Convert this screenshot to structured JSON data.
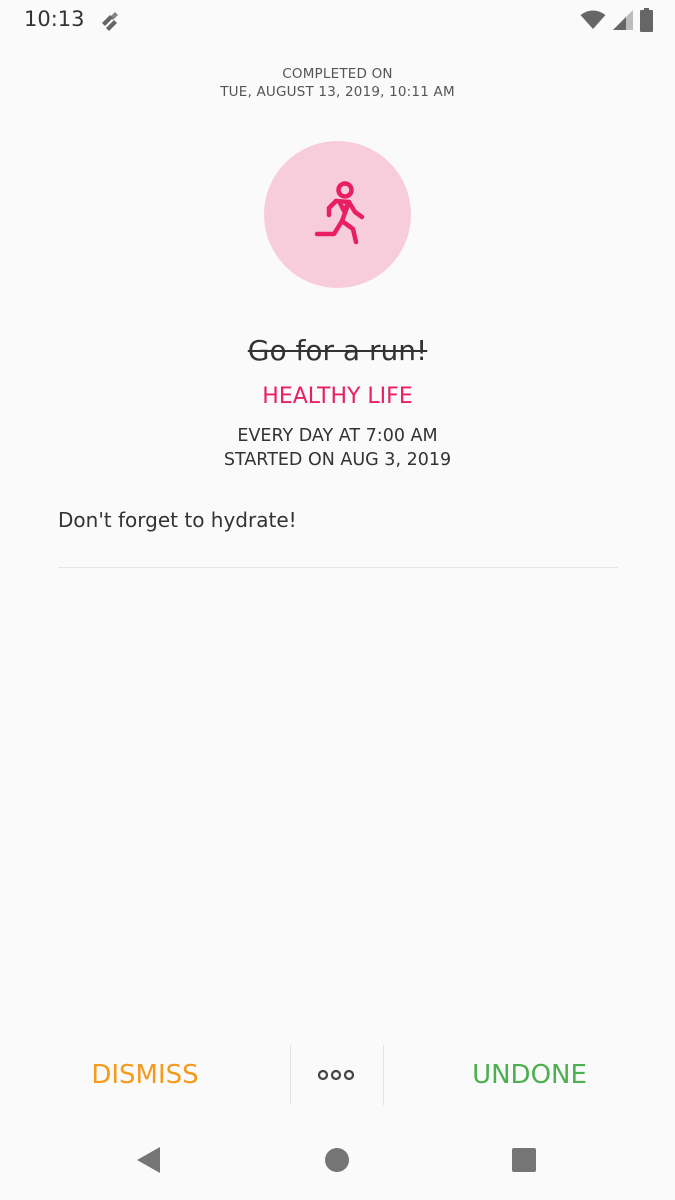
{
  "status_bar": {
    "time": "10:13",
    "icons": [
      "app-notification-icon",
      "wifi-icon",
      "cellular-signal-icon",
      "battery-icon"
    ]
  },
  "completion": {
    "label": "COMPLETED ON",
    "date": "TUE, AUGUST 13, 2019, 10:11 AM"
  },
  "task": {
    "icon": "running-person-icon",
    "title": "Go for a run!",
    "category": "HEALTHY LIFE",
    "schedule": "EVERY DAY AT 7:00 AM",
    "started": "STARTED ON AUG 3, 2019",
    "note": "Don't forget to hydrate!"
  },
  "actions": {
    "dismiss_label": "DISMISS",
    "more_icon": "more-options-icon",
    "undone_label": "UNDONE"
  },
  "navigation": {
    "icons": [
      "back-icon",
      "home-icon",
      "recents-icon"
    ]
  },
  "colors": {
    "background": "#fafafa",
    "accent_pink": "#e91e63",
    "circle_pink": "#f7ccdb",
    "dismiss_orange": "#f59b1b",
    "undone_green": "#4caf50",
    "text_dark": "#333333"
  }
}
